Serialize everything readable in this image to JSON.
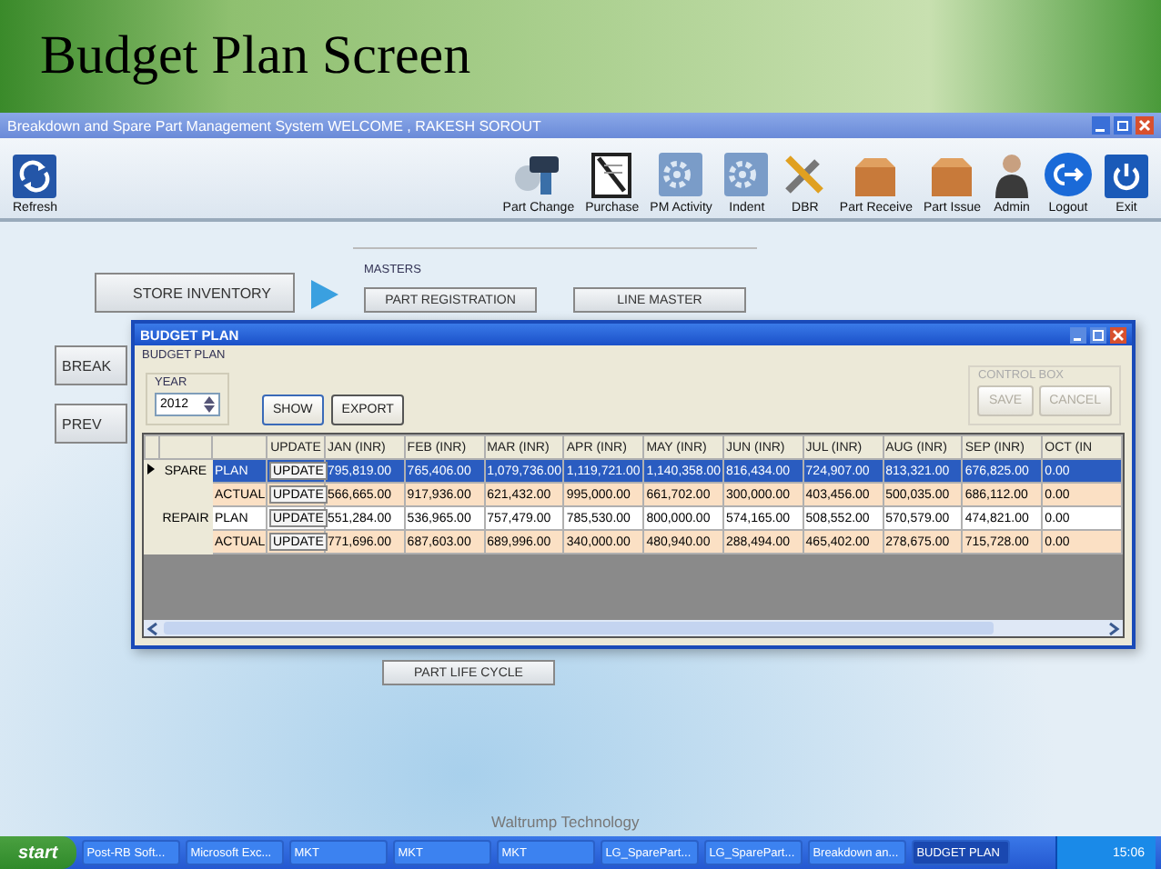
{
  "slide": {
    "title": "Budget Plan Screen",
    "footer": "Waltrump Technology"
  },
  "window": {
    "title": "Breakdown and Spare Part Management System WELCOME , RAKESH SOROUT"
  },
  "toolbar": [
    {
      "label": "Refresh"
    },
    {
      "label": "Part Change"
    },
    {
      "label": "Purchase"
    },
    {
      "label": "PM Activity"
    },
    {
      "label": "Indent"
    },
    {
      "label": "DBR"
    },
    {
      "label": "Part Receive"
    },
    {
      "label": "Part Issue"
    },
    {
      "label": "Admin"
    },
    {
      "label": "Logout"
    },
    {
      "label": "Exit"
    }
  ],
  "left_buttons": [
    "STORE INVENTORY",
    "BREAK",
    "PREV"
  ],
  "masters": {
    "title": "MASTERS",
    "buttons": [
      "PART REGISTRATION",
      "LINE MASTER",
      "PART LIFE CYCLE"
    ]
  },
  "dialog": {
    "title": "BUDGET PLAN",
    "group_title": "BUDGET PLAN",
    "year_label": "YEAR",
    "year": "2012",
    "buttons": [
      "SHOW",
      "EXPORT"
    ],
    "control_box": {
      "title": "CONTROL BOX",
      "buttons": [
        {
          "label": "SAVE",
          "disabled": true
        },
        {
          "label": "CANCEL",
          "disabled": true
        }
      ]
    },
    "grid": {
      "columns": [
        "UPDATE",
        "JAN (INR)",
        "FEB (INR)",
        "MAR (INR)",
        "APR (INR)",
        "MAY (INR)",
        "JUN (INR)",
        "JUL (INR)",
        "AUG (INR)",
        "SEP (INR)",
        "OCT (IN"
      ],
      "rows": [
        {
          "group": "SPARE",
          "type": "PLAN",
          "kind": "plan",
          "selected": true,
          "button": "UPDATE",
          "values": [
            "795,819.00",
            "765,406.00",
            "1,079,736.00",
            "1,119,721.00",
            "1,140,358.00",
            "816,434.00",
            "724,907.00",
            "813,321.00",
            "676,825.00",
            "0.00"
          ]
        },
        {
          "group": "",
          "type": "ACTUAL",
          "kind": "actual",
          "selected": false,
          "button": "UPDATE",
          "values": [
            "566,665.00",
            "917,936.00",
            "621,432.00",
            "995,000.00",
            "661,702.00",
            "300,000.00",
            "403,456.00",
            "500,035.00",
            "686,112.00",
            "0.00"
          ]
        },
        {
          "group": "REPAIR",
          "type": "PLAN",
          "kind": "plan",
          "selected": false,
          "button": "UPDATE",
          "values": [
            "551,284.00",
            "536,965.00",
            "757,479.00",
            "785,530.00",
            "800,000.00",
            "574,165.00",
            "508,552.00",
            "570,579.00",
            "474,821.00",
            "0.00"
          ]
        },
        {
          "group": "",
          "type": "ACTUAL",
          "kind": "actual",
          "selected": false,
          "button": "UPDATE",
          "values": [
            "771,696.00",
            "687,603.00",
            "689,996.00",
            "340,000.00",
            "480,940.00",
            "288,494.00",
            "465,402.00",
            "278,675.00",
            "715,728.00",
            "0.00"
          ]
        }
      ]
    }
  },
  "taskbar": {
    "start": "start",
    "items": [
      {
        "label": "Post-RB Soft...",
        "selected": false
      },
      {
        "label": "Microsoft Exc...",
        "selected": false
      },
      {
        "label": "MKT",
        "selected": false
      },
      {
        "label": "MKT",
        "selected": false
      },
      {
        "label": "MKT",
        "selected": false
      },
      {
        "label": "LG_SparePart...",
        "selected": false
      },
      {
        "label": "LG_SparePart...",
        "selected": false
      },
      {
        "label": "Breakdown an...",
        "selected": false
      },
      {
        "label": "BUDGET PLAN",
        "selected": true
      }
    ],
    "clock": "15:06"
  }
}
